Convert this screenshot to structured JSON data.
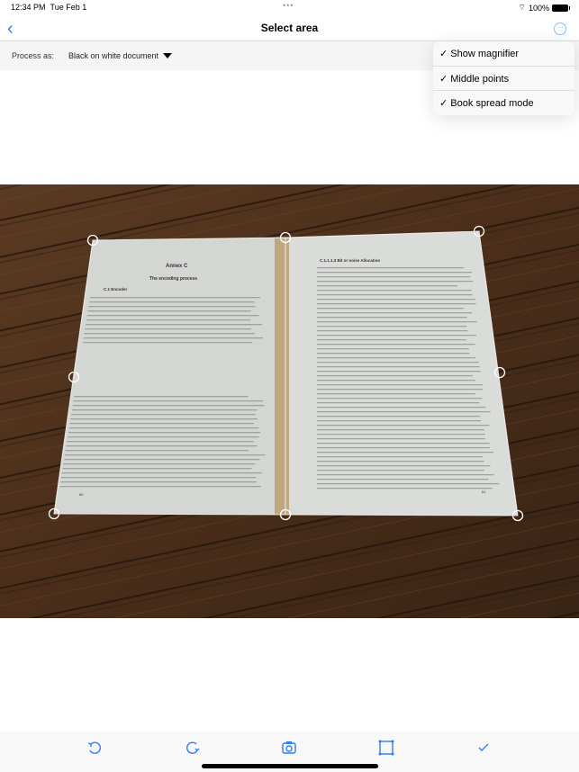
{
  "status": {
    "time": "12:34 PM",
    "date": "Tue Feb 1",
    "dots": "•••",
    "battery": "100%"
  },
  "nav": {
    "back_icon": "chevron-left-icon",
    "title": "Select area",
    "more_icon": "ellipsis-circle-icon"
  },
  "process": {
    "label": "Process as:",
    "value": "Black on white document"
  },
  "menu": {
    "items": [
      {
        "label": "✓ Show magnifier"
      },
      {
        "label": "✓ Middle points"
      },
      {
        "label": "✓ Book spread mode"
      }
    ]
  },
  "document": {
    "left_title": "Annex C",
    "left_subtitle": "The encoding process",
    "left_section": "C.1   Encoder",
    "right_section": "C.1.1.1.3   Bit or noise Allocation",
    "left_page_no": "60",
    "right_page_no": "61"
  },
  "toolbar": {
    "icons": [
      "rotate-left-icon",
      "rotate-right-icon",
      "camera-icon",
      "crop-frame-icon",
      "checkmark-icon"
    ]
  },
  "colors": {
    "accent": "#2f7cf6"
  }
}
